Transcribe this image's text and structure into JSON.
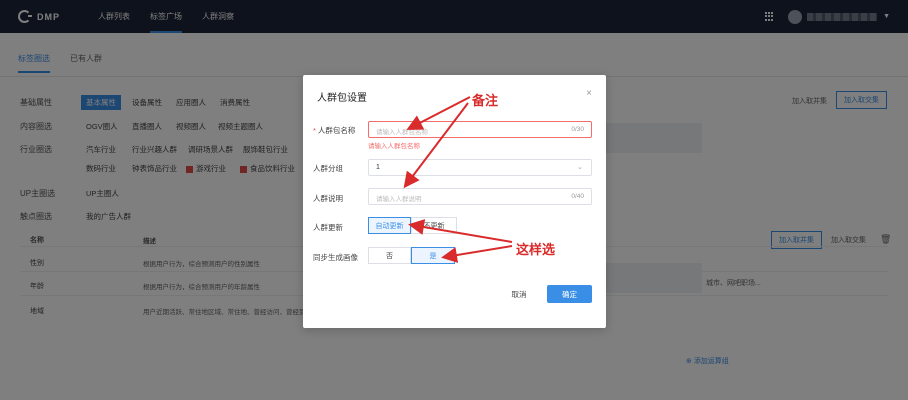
{
  "topbar": {
    "logo_text": "DMP",
    "nav": [
      "人群列表",
      "标签广场",
      "人群洞察"
    ],
    "active_nav": "标签广场"
  },
  "page": {
    "subtabs": [
      "标签圈选",
      "已有人群"
    ],
    "row1_label": "基础属性",
    "row1_chips": [
      "基本属性",
      "设备属性",
      "应用圈人",
      "消费属性"
    ],
    "row2_label": "内容圈选",
    "row2_chips": [
      "OGV圈人",
      "直播圈人",
      "视频圈人",
      "视频主题圈人"
    ],
    "row3_label": "行业圈选",
    "row3_chips": [
      "汽车行业",
      "行业兴趣人群",
      "调研场景人群",
      "服饰鞋包行业"
    ],
    "row3b_chips": [
      "数码行业",
      "钟表饰品行业",
      "游戏行业",
      "食品饮料行业"
    ],
    "row4_label": "UP主圈选",
    "row4_chip": "UP主圈人",
    "row5_label": "触点圈选",
    "row5_chip": "我的广告人群",
    "right_btn1": "加入取并集",
    "right_btn2": "加入取交集",
    "table_btn1": "加入取并集",
    "table_btn2": "加入取交集",
    "table_headers": [
      "名称",
      "描述"
    ],
    "table_rows": [
      {
        "name": "性别",
        "desc": "根据用户行为，综合预测用户的性别属性"
      },
      {
        "name": "年龄",
        "desc": "根据用户行为，综合预测用户的年龄属性"
      },
      {
        "name": "地域",
        "desc": "用户近期活跃、常住地区域、常住地、曾经访问、曾经到访城市"
      }
    ],
    "add_condition": "添加运算组",
    "grey_hint": "城市、网吧职场..."
  },
  "modal": {
    "title": "人群包设置",
    "close_icon": "×",
    "name_label": "人群包名称",
    "name_placeholder": "请输入人群包名称",
    "name_count": "0/30",
    "name_error": "请输入人群包名称",
    "group_label": "人群分组",
    "group_value": "1",
    "desc_label": "人群说明",
    "desc_placeholder": "请输入人群说明",
    "desc_count": "0/40",
    "update_label": "人群更新",
    "update_options": [
      "自动更新",
      "不更新"
    ],
    "update_selected": "自动更新",
    "portrait_label": "同步生成画像",
    "portrait_options": [
      "否",
      "是"
    ],
    "portrait_selected": "是",
    "cancel_label": "取消",
    "confirm_label": "确定"
  },
  "annotations": {
    "note_label": "备注",
    "choose_label": "这样选"
  },
  "colors": {
    "primary": "#3a8ee6",
    "annotation": "#d92b2b",
    "topbar": "#1c2438"
  }
}
